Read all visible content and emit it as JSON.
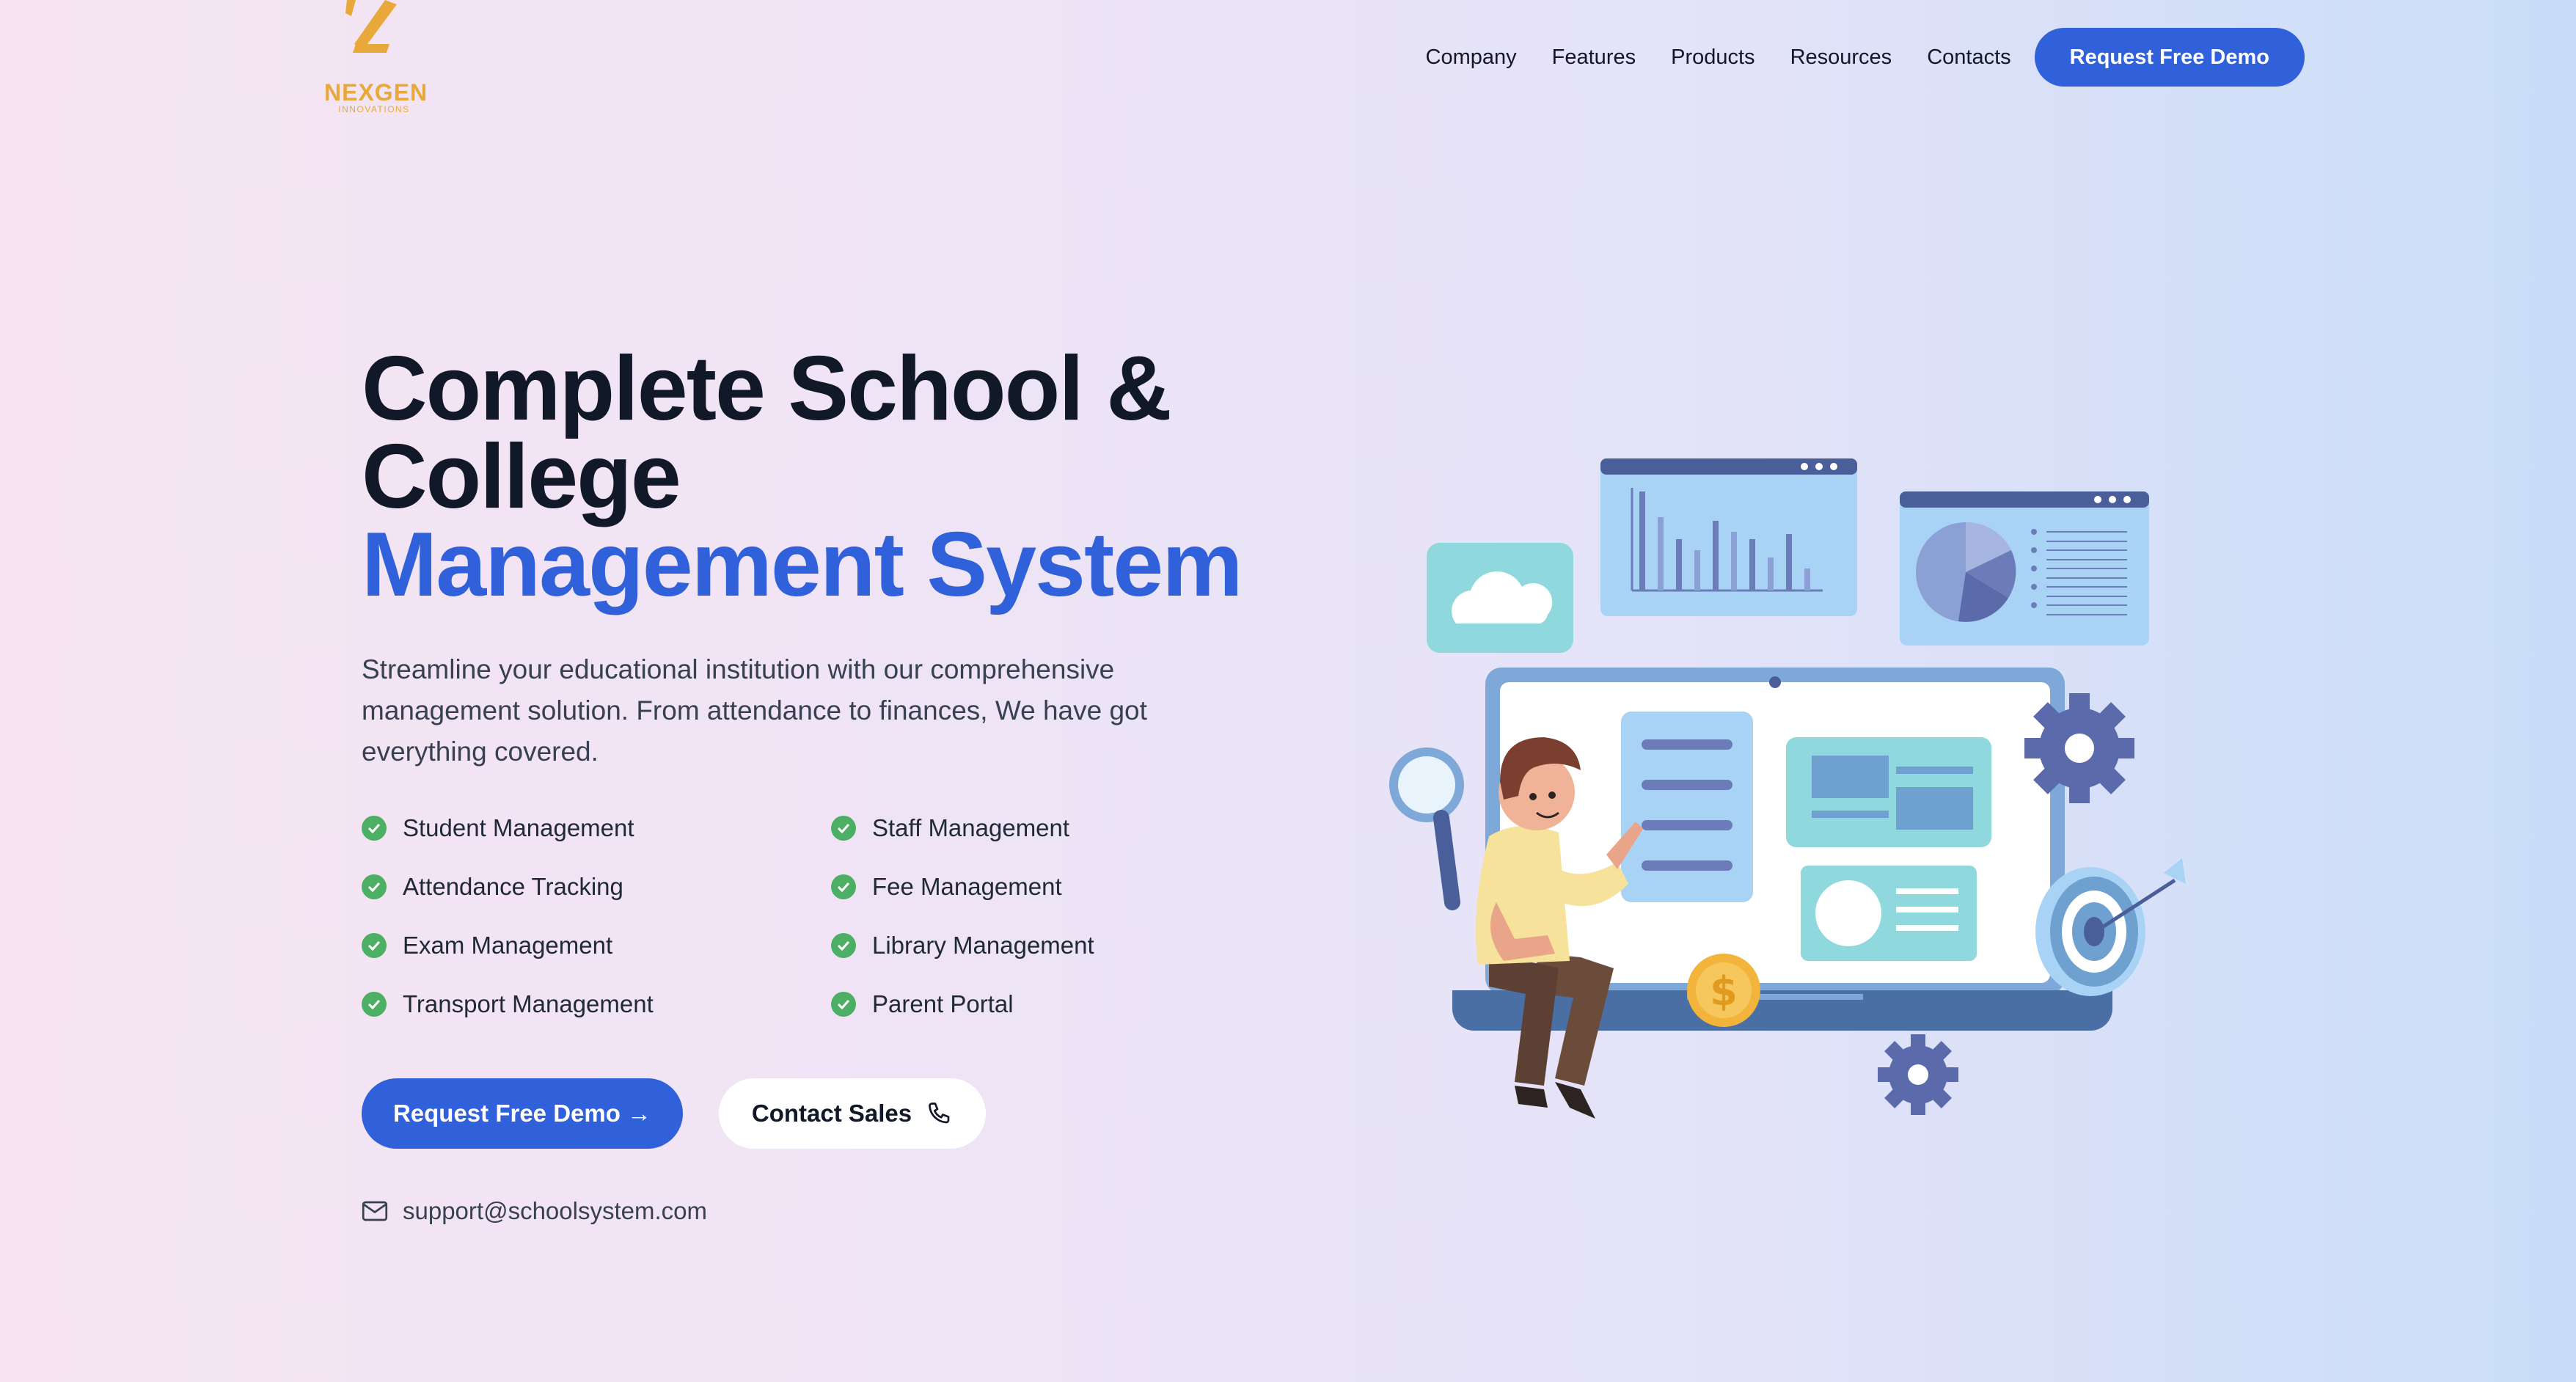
{
  "brand": {
    "name": "NEXGEN",
    "tagline": "INNOVATIONS",
    "accent_color": "#e8a93a"
  },
  "nav": {
    "links": [
      "Company",
      "Features",
      "Products",
      "Resources",
      "Contacts"
    ],
    "cta_label": "Request Free Demo"
  },
  "hero": {
    "title_line1": "Complete School &",
    "title_line2": "College",
    "title_accent": "Management System",
    "subtitle": "Streamline your educational institution with our comprehensive management solution. From attendance to finances, We have got everything covered.",
    "features": [
      "Student Management",
      "Staff Management",
      "Attendance Tracking",
      "Fee Management",
      "Exam Management",
      "Library Management",
      "Transport Management",
      "Parent Portal"
    ],
    "primary_button": "Request Free Demo →",
    "secondary_button": "Contact Sales",
    "email": "support@schoolsystem.com"
  },
  "colors": {
    "primary": "#3061db",
    "check": "#4caf63",
    "heading": "#111827"
  },
  "icons": {
    "check": "check-circle-icon",
    "phone": "phone-icon",
    "mail": "mail-icon"
  }
}
